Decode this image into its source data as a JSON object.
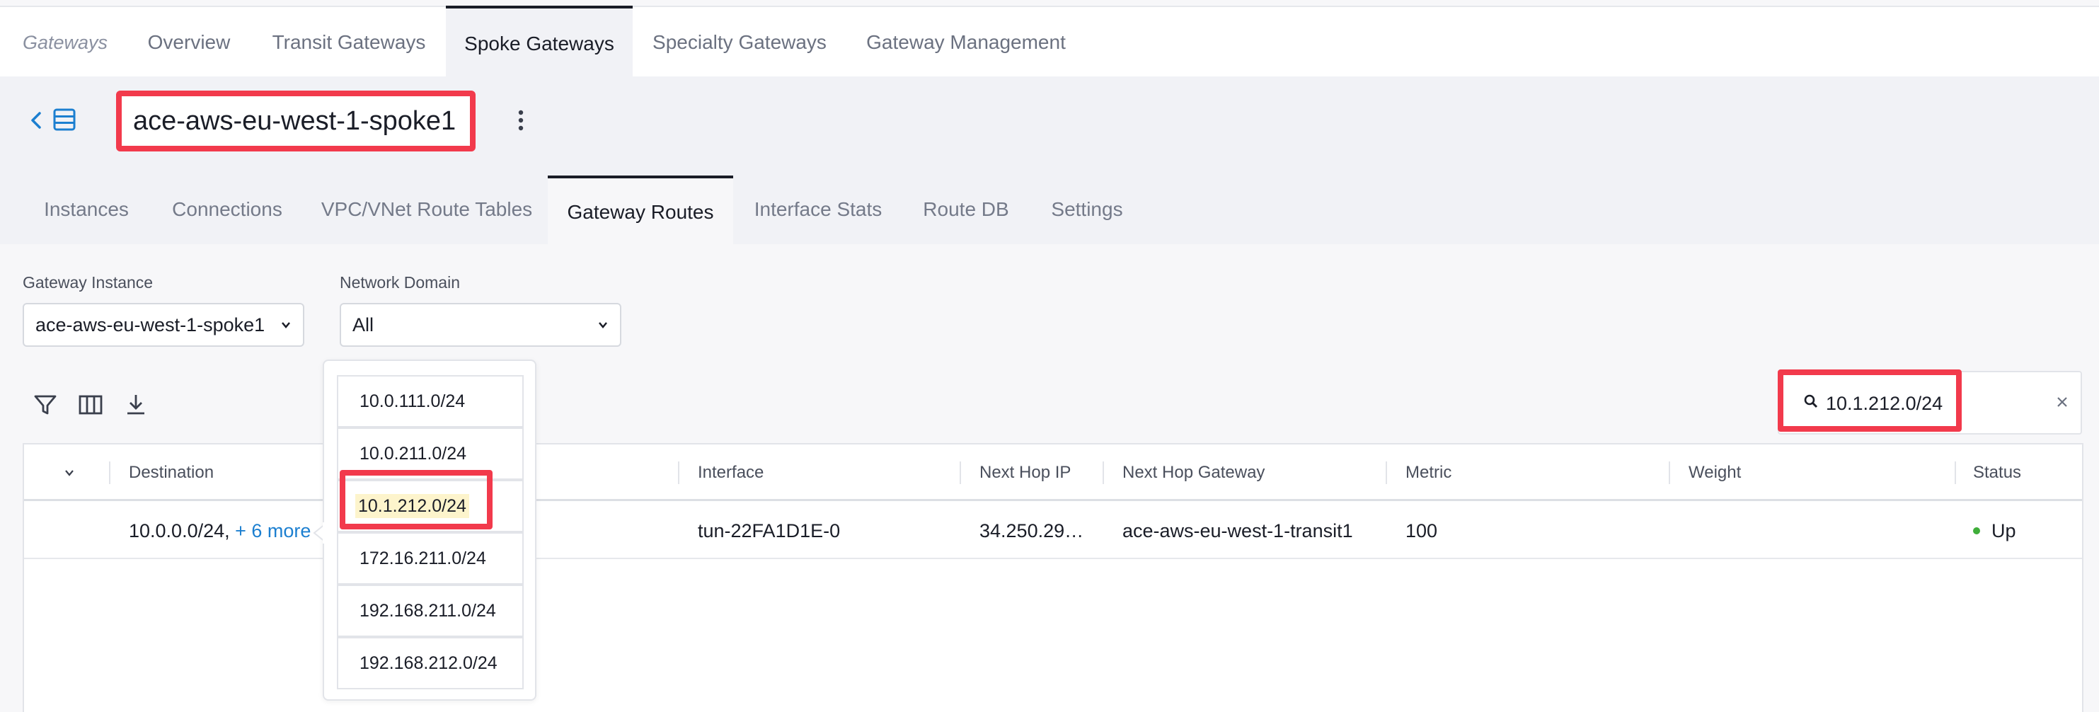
{
  "top_nav": {
    "crumb": "Gateways",
    "tabs": [
      {
        "label": "Overview"
      },
      {
        "label": "Transit Gateways"
      },
      {
        "label": "Spoke Gateways",
        "active": true
      },
      {
        "label": "Specialty Gateways"
      },
      {
        "label": "Gateway Management"
      }
    ]
  },
  "header": {
    "gateway_name": "ace-aws-eu-west-1-spoke1"
  },
  "sub_tabs": [
    {
      "label": "Instances"
    },
    {
      "label": "Connections"
    },
    {
      "label": "VPC/VNet Route Tables"
    },
    {
      "label": "Gateway Routes",
      "active": true
    },
    {
      "label": "Interface Stats"
    },
    {
      "label": "Route DB"
    },
    {
      "label": "Settings"
    }
  ],
  "filters": {
    "gateway_instance": {
      "label": "Gateway Instance",
      "value": "ace-aws-eu-west-1-spoke1"
    },
    "network_domain": {
      "label": "Network Domain",
      "value": "All"
    }
  },
  "search": {
    "value": "10.1.212.0/24"
  },
  "table": {
    "columns": [
      "Destination",
      "Interface",
      "Next Hop IP",
      "Next Hop Gateway",
      "Metric",
      "Weight",
      "Status"
    ],
    "rows": [
      {
        "destination": "10.0.0.0/24,",
        "more": "+ 6 more",
        "interface": "tun-22FA1D1E-0",
        "next_hop_ip": "34.250.29…",
        "next_hop_gateway": "ace-aws-eu-west-1-transit1",
        "metric": "100",
        "weight": "",
        "status": "Up"
      }
    ]
  },
  "popover": {
    "items": [
      "10.0.111.0/24",
      "10.0.211.0/24",
      "10.1.212.0/24",
      "172.16.211.0/24",
      "192.168.211.0/24",
      "192.168.212.0/24"
    ],
    "highlighted_item": "10.1.212.0/24"
  },
  "colors": {
    "highlight_border": "#f23a4c",
    "link": "#1c7fd0",
    "status_up": "#3fae3a",
    "search_match": "#fdf4cc"
  }
}
